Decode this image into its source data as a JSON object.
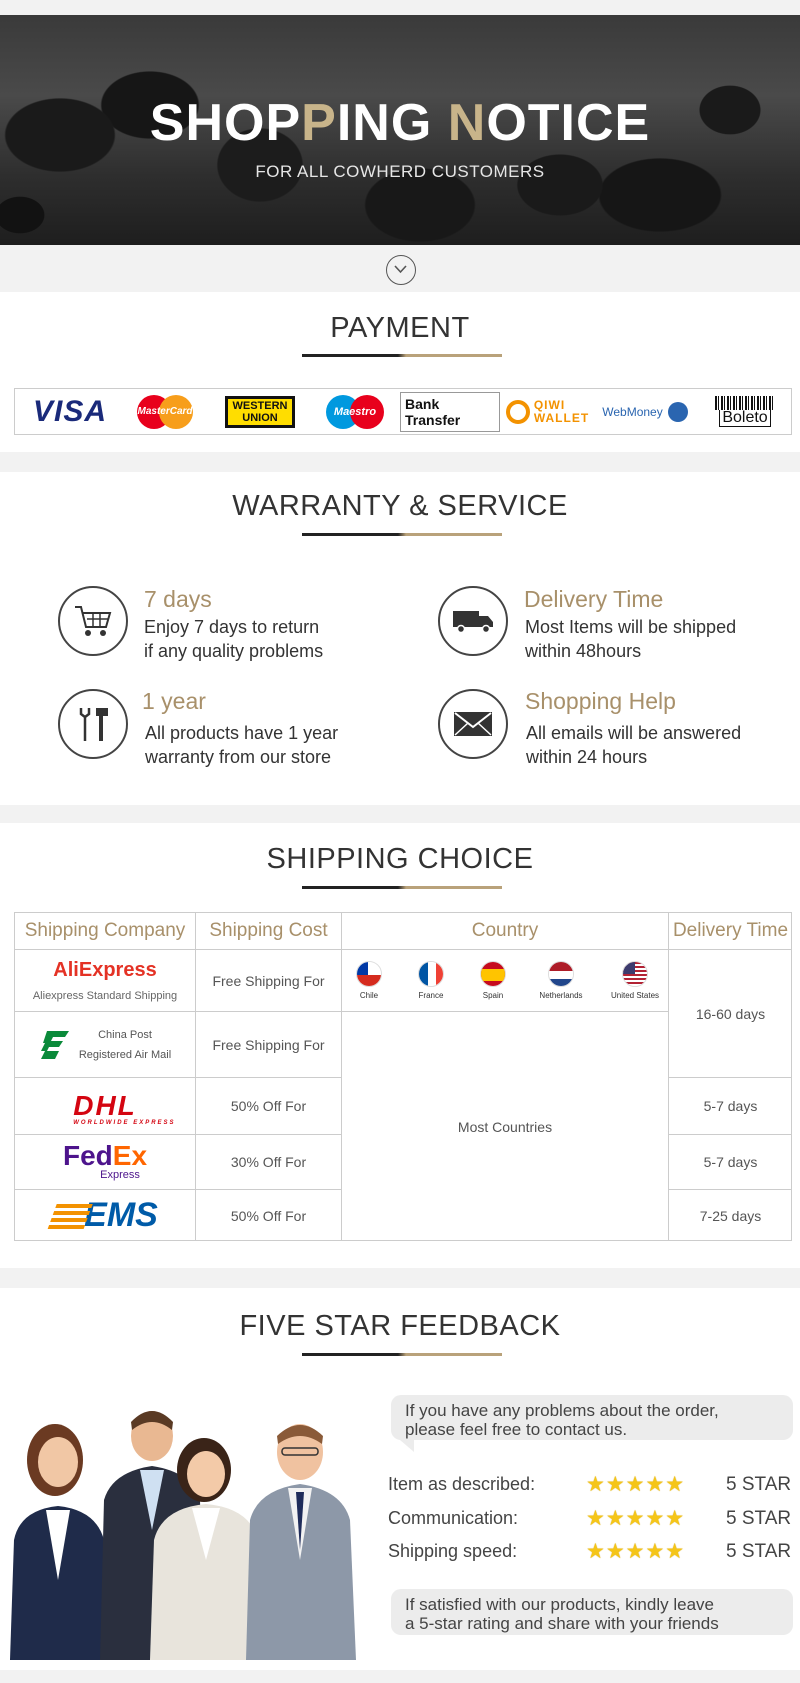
{
  "hero": {
    "title_part1": "SHOP",
    "title_part2": "P",
    "title_part3": "ING ",
    "title_part4": "N",
    "title_part5": "OTICE",
    "subtitle": "FOR ALL COWHERD CUSTOMERS"
  },
  "payment": {
    "title": "PAYMENT",
    "methods": {
      "visa": "VISA",
      "mastercard": "MasterCard",
      "western_union_1": "WESTERN",
      "western_union_2": "UNION",
      "maestro": "Maestro",
      "bank_transfer": "Bank Transfer",
      "qiwi_1": "QIWI",
      "qiwi_2": "WALLET",
      "webmoney": "WebMoney",
      "boleto": "Boleto"
    }
  },
  "warranty": {
    "title": "WARRANTY & SERVICE",
    "items": [
      {
        "icon": "cart-icon",
        "heading": "7 days",
        "line1": "Enjoy 7 days to return",
        "line2": "if any quality problems"
      },
      {
        "icon": "truck-icon",
        "heading": "Delivery Time",
        "line1": "Most Items will be shipped",
        "line2": "within 48hours"
      },
      {
        "icon": "tools-icon",
        "heading": "1 year",
        "line1": "All products have 1 year",
        "line2": "warranty from our store"
      },
      {
        "icon": "envelope-icon",
        "heading": "Shopping Help",
        "line1": "All emails will be answered",
        "line2": "within 24 hours"
      }
    ]
  },
  "shipping": {
    "title": "SHIPPING CHOICE",
    "headers": [
      "Shipping Company",
      "Shipping Cost",
      "Country",
      "Delivery Time"
    ],
    "rows": [
      {
        "company": "AliExpress",
        "company_sub": "Aliexpress Standard Shipping",
        "cost": "Free Shipping For"
      },
      {
        "company": "China Post",
        "company_sub": "Registered Air Mail",
        "cost": "Free Shipping For"
      },
      {
        "company": "DHL",
        "company_sub": "WORLDWIDE EXPRESS",
        "cost": "50% Off For"
      },
      {
        "company": "FedEx",
        "company_sub": "Express",
        "cost": "30% Off For"
      },
      {
        "company": "EMS",
        "company_sub": "",
        "cost": "50% Off For"
      }
    ],
    "countries": [
      "Chile",
      "France",
      "Spain",
      "Netherlands",
      "United States"
    ],
    "most_countries": "Most Countries",
    "delivery_times": [
      "16-60 days",
      "5-7 days",
      "5-7 days",
      "7-25 days"
    ]
  },
  "feedback": {
    "title": "FIVE STAR FEEDBACK",
    "bubble_top_1": "If you have any problems about the order,",
    "bubble_top_2": "please feel free to contact us.",
    "ratings": [
      {
        "label": "Item as described:",
        "stars": 5,
        "value": "5 STAR"
      },
      {
        "label": "Communication:",
        "stars": 5,
        "value": "5 STAR"
      },
      {
        "label": "Shipping speed:",
        "stars": 5,
        "value": "5 STAR"
      }
    ],
    "bubble_bottom_1": "If satisfied with our products, kindly leave",
    "bubble_bottom_2": "a 5-star rating and share with your friends"
  },
  "colors": {
    "gold": "#a8906a",
    "dark": "#333333"
  }
}
